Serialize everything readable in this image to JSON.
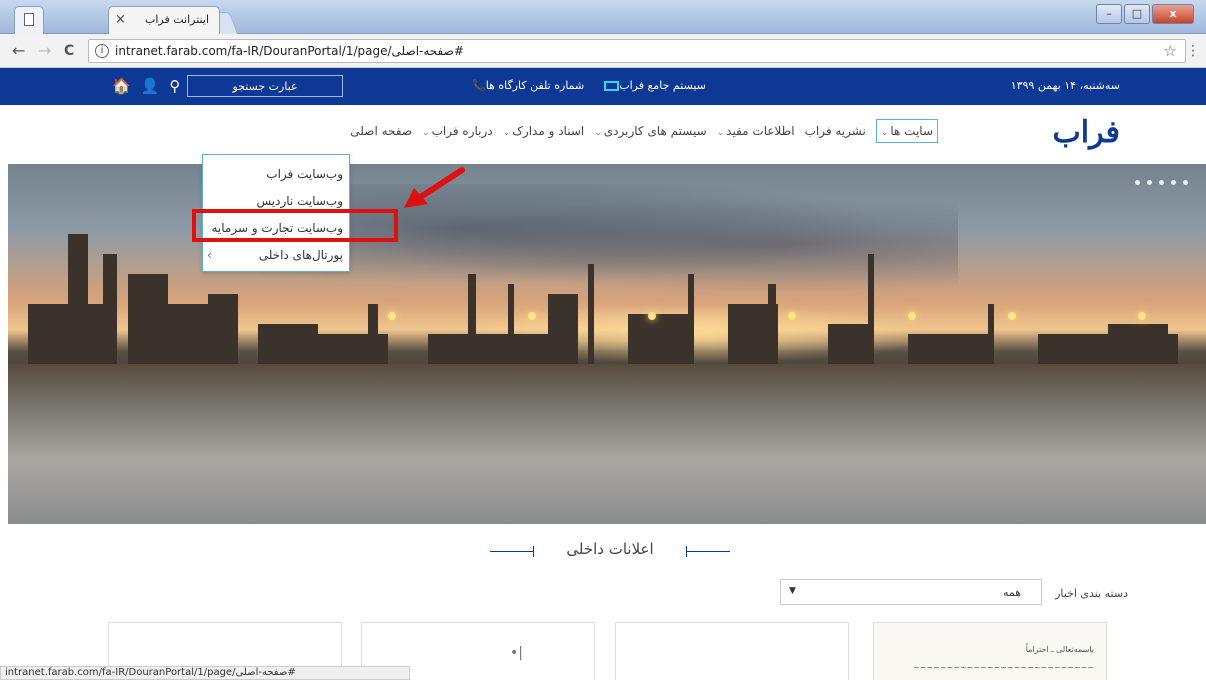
{
  "browser": {
    "tab_title": "اینترانت فراب",
    "tab_close": "×",
    "url": "intranet.farab.com/fa-IR/DouranPortal/1/page/صفحه-اصلی#",
    "status_url": "intranet.farab.com/fa-IR/DouranPortal/1/page/صفحه-اصلی#",
    "back": "←",
    "forward": "→",
    "reload": "C",
    "info": "i",
    "bookmark": "☆",
    "menu": "⋮",
    "win_minimize": "–",
    "win_maximize": "□",
    "win_close": "x"
  },
  "topbar": {
    "date": "سه‌شنبه، ۱۴ بهمن ۱۳۹۹",
    "link_system": "سیستم جامع فراب",
    "link_phone": "شماره تلفن کارگاه ها",
    "search_placeholder": "عبارت جستجو",
    "icons": [
      "search-icon",
      "user-icon",
      "home-icon"
    ]
  },
  "nav": {
    "logo": "فراب",
    "items": [
      {
        "label": "صفحه اصلی",
        "caret": false
      },
      {
        "label": "درباره فراب",
        "caret": true
      },
      {
        "label": "اسناد و مدارک",
        "caret": true
      },
      {
        "label": "سیستم های کاربردی",
        "caret": true
      },
      {
        "label": "اطلاعات مفید",
        "caret": true
      },
      {
        "label": "نشریه فراب",
        "caret": false
      },
      {
        "label": "سایت ها",
        "caret": true
      }
    ],
    "caret_char": "⌄"
  },
  "dropdown": {
    "items": [
      {
        "label": "وب‌سایت فراب"
      },
      {
        "label": "وب‌سایت ناردیس"
      },
      {
        "label": "وب‌سایت تجارت و سرمایه"
      },
      {
        "label": "پورتال‌های داخلی",
        "submenu": "›"
      }
    ]
  },
  "announcements": {
    "title": "اعلانات داخلی",
    "filter_label": "دسته بندی اخبار",
    "filter_value": "همه",
    "filter_arrow": "▼"
  },
  "colors": {
    "brand_blue": "#0d3896",
    "highlight_red": "#e01010",
    "dropdown_border": "#5ab3d1"
  }
}
